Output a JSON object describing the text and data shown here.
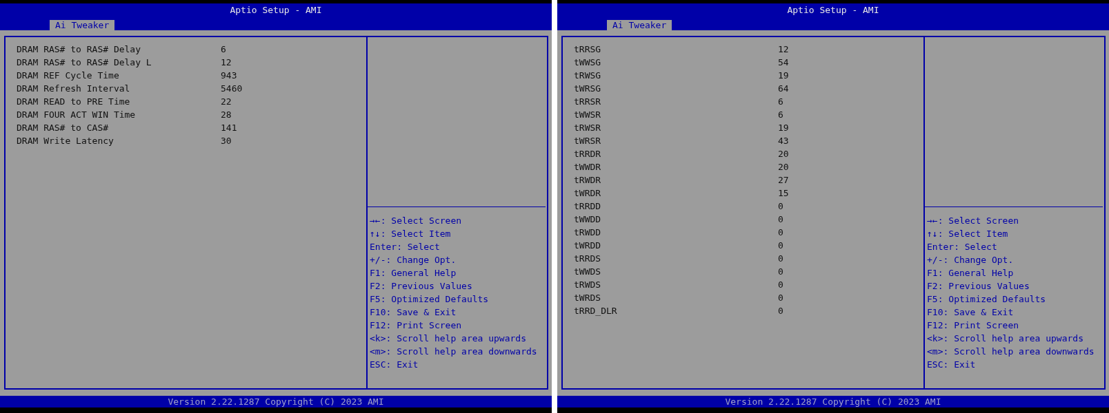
{
  "screens": [
    {
      "title": "Aptio Setup - AMI",
      "tabs": [
        {
          "label": "Ai Tweaker",
          "selected": true
        }
      ],
      "items": [
        {
          "label": "DRAM RAS# to RAS# Delay",
          "value": "6"
        },
        {
          "label": "DRAM RAS# to RAS# Delay L",
          "value": "12"
        },
        {
          "label": "DRAM REF Cycle Time",
          "value": "943"
        },
        {
          "label": "DRAM Refresh Interval",
          "value": "5460"
        },
        {
          "label": "DRAM READ to PRE Time",
          "value": "22"
        },
        {
          "label": "DRAM FOUR ACT WIN Time",
          "value": "28"
        },
        {
          "label": "DRAM RAS# to CAS#",
          "value": "141"
        },
        {
          "label": "DRAM Write Latency",
          "value": "30"
        }
      ],
      "help": [
        "→←: Select Screen",
        "↑↓: Select Item",
        "Enter: Select",
        "+/-: Change Opt.",
        "F1: General Help",
        "F2: Previous Values",
        "F5: Optimized Defaults",
        "F10: Save & Exit",
        "F12: Print Screen",
        "<k>: Scroll help area upwards",
        "<m>: Scroll help area downwards",
        "ESC: Exit"
      ],
      "footer": "Version 2.22.1287 Copyright (C) 2023 AMI"
    },
    {
      "title": "Aptio Setup - AMI",
      "tabs": [
        {
          "label": "Ai Tweaker",
          "selected": true
        }
      ],
      "items": [
        {
          "label": "tRRSG",
          "value": "12"
        },
        {
          "label": "tWWSG",
          "value": "54"
        },
        {
          "label": "tRWSG",
          "value": "19"
        },
        {
          "label": "tWRSG",
          "value": "64"
        },
        {
          "label": "tRRSR",
          "value": "6"
        },
        {
          "label": "tWWSR",
          "value": "6"
        },
        {
          "label": "tRWSR",
          "value": "19"
        },
        {
          "label": "tWRSR",
          "value": "43"
        },
        {
          "label": "tRRDR",
          "value": "20"
        },
        {
          "label": "tWWDR",
          "value": "20"
        },
        {
          "label": "tRWDR",
          "value": "27"
        },
        {
          "label": "tWRDR",
          "value": "15"
        },
        {
          "label": "tRRDD",
          "value": "0"
        },
        {
          "label": "tWWDD",
          "value": "0"
        },
        {
          "label": "tRWDD",
          "value": "0"
        },
        {
          "label": "tWRDD",
          "value": "0"
        },
        {
          "label": "tRRDS",
          "value": "0"
        },
        {
          "label": "tWWDS",
          "value": "0"
        },
        {
          "label": "tRWDS",
          "value": "0"
        },
        {
          "label": "tWRDS",
          "value": "0"
        },
        {
          "label": "tRRD_DLR",
          "value": "0"
        }
      ],
      "help": [
        "→←: Select Screen",
        "↑↓: Select Item",
        "Enter: Select",
        "+/-: Change Opt.",
        "F1: General Help",
        "F2: Previous Values",
        "F5: Optimized Defaults",
        "F10: Save & Exit",
        "F12: Print Screen",
        "<k>: Scroll help area upwards",
        "<m>: Scroll help area downwards",
        "ESC: Exit"
      ],
      "footer": "Version 2.22.1287 Copyright (C) 2023 AMI"
    }
  ]
}
